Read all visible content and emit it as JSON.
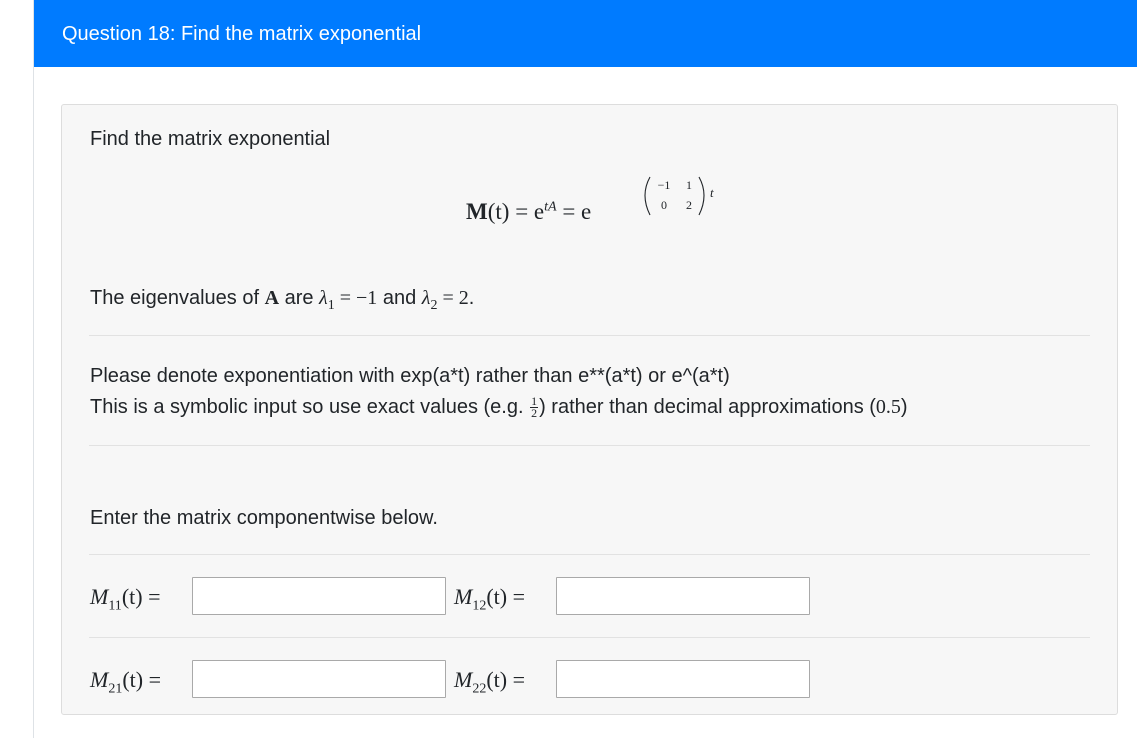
{
  "header": {
    "title": "Question 18: Find the matrix exponential"
  },
  "problem": {
    "intro": "Find the matrix exponential",
    "equation": {
      "lhs": "M",
      "arg": "(t)",
      "eq1": " = e",
      "exp1": "tA",
      "eq2": " = e",
      "matrix": [
        "−1",
        "1",
        "0",
        "2"
      ],
      "exp_var": "t"
    },
    "eigen": {
      "prefix": "The eigenvalues of ",
      "matrix_symbol": "A",
      "are": " are ",
      "lambda1": "λ",
      "sub1": "1",
      "val1": " = −1",
      "and": " and ",
      "lambda2": "λ",
      "sub2": "2",
      "val2": " = 2",
      "period": "."
    },
    "note1": "Please denote exponentiation with exp(a*t) rather than e**(a*t) or e^(a*t)",
    "note2_prefix": "This is a symbolic input so use exact values (e.g. ",
    "note2_frac_num": "1",
    "note2_frac_den": "2",
    "note2_mid": ") rather than decimal approximations (",
    "note2_decimal": "0.5",
    "note2_suffix": ")",
    "instruction": "Enter the matrix componentwise below."
  },
  "answers": [
    {
      "symbol": "M",
      "sub": "11",
      "arg": "(t)",
      "eq": " =",
      "value": ""
    },
    {
      "symbol": "M",
      "sub": "12",
      "arg": "(t)",
      "eq": " =",
      "value": ""
    },
    {
      "symbol": "M",
      "sub": "21",
      "arg": "(t)",
      "eq": " =",
      "value": ""
    },
    {
      "symbol": "M",
      "sub": "22",
      "arg": "(t)",
      "eq": " =",
      "value": ""
    }
  ]
}
